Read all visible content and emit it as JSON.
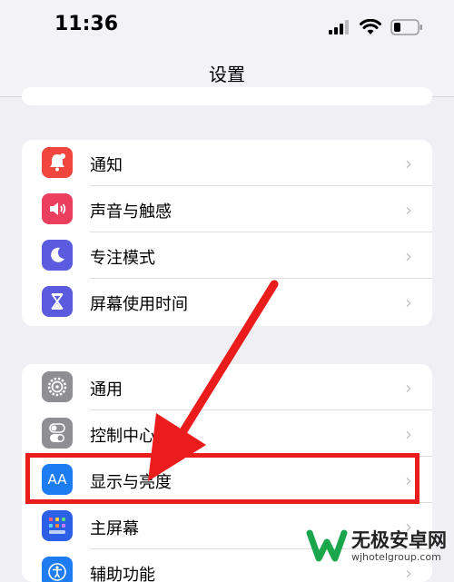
{
  "status_bar": {
    "time": "11:36"
  },
  "header": {
    "title": "设置"
  },
  "groups": [
    {
      "items": [
        {
          "label": "通知",
          "icon": "notification-bell-icon",
          "color": "#f0463e"
        },
        {
          "label": "声音与触感",
          "icon": "speaker-icon",
          "color": "#ec3f5e"
        },
        {
          "label": "专注模式",
          "icon": "moon-icon",
          "color": "#5b5be0"
        },
        {
          "label": "屏幕使用时间",
          "icon": "hourglass-icon",
          "color": "#5b5be0"
        }
      ]
    },
    {
      "items": [
        {
          "label": "通用",
          "icon": "gear-icon",
          "color": "#8e8e93"
        },
        {
          "label": "控制中心",
          "icon": "control-toggles-icon",
          "color": "#8e8e93"
        },
        {
          "label": "显示与亮度",
          "icon": "aa-text-icon",
          "color": "#1e7cf3",
          "icon_text": "AA"
        },
        {
          "label": "主屏幕",
          "icon": "app-grid-icon",
          "color": "#2b5fe6"
        },
        {
          "label": "辅助功能",
          "icon": "accessibility-icon",
          "color": "#1e7cf3"
        }
      ]
    }
  ],
  "watermark": {
    "title": "无极安卓网",
    "url": "wjhotelgroup.com"
  },
  "annotation_color": "#ea1c1c"
}
